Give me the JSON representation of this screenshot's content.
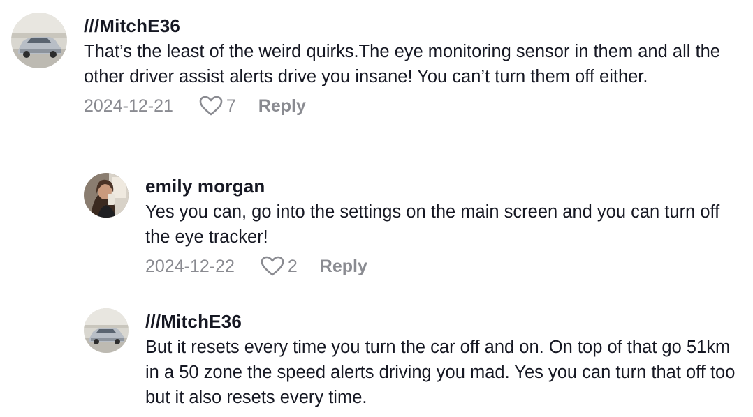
{
  "comments": [
    {
      "username": "///MitchE36",
      "text": "That’s the least of the weird quirks.The eye monitoring sensor in them and all the other driver assist alerts drive you insane! You can’t turn them off either.",
      "date": "2024-12-21",
      "likes": "7",
      "reply_label": "Reply",
      "avatar": "car-photo"
    },
    {
      "username": "emily morgan",
      "text": "Yes you can, go into the settings on the main screen and you can turn off the eye tracker!",
      "date": "2024-12-22",
      "likes": "2",
      "reply_label": "Reply",
      "avatar": "person-photo"
    },
    {
      "username": "///MitchE36",
      "text": "But it resets every time you turn the car off and on. On top of that go 51km in a 50 zone the speed alerts driving you mad. Yes you can turn that off too but it also resets every time.",
      "avatar": "car-photo"
    }
  ],
  "icons": {
    "like": "heart-outline-icon"
  },
  "colors": {
    "text": "#161823",
    "meta": "#8a8b91"
  }
}
